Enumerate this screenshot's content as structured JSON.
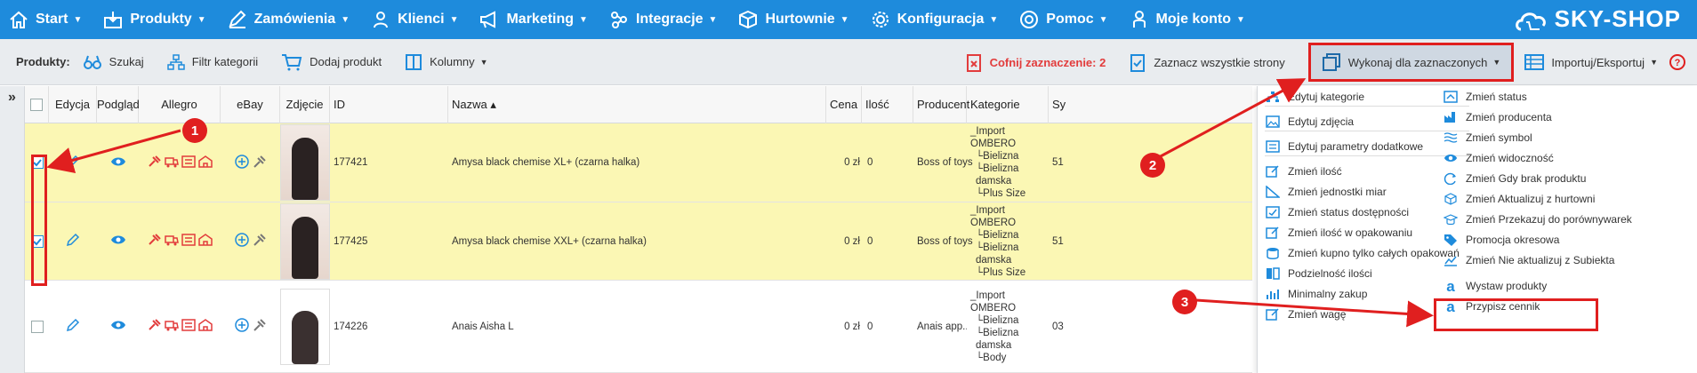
{
  "nav": {
    "items": [
      {
        "label": "Start",
        "icon": "home-icon"
      },
      {
        "label": "Produkty",
        "icon": "box-download-icon"
      },
      {
        "label": "Zamówienia",
        "icon": "pencil-icon"
      },
      {
        "label": "Klienci",
        "icon": "user-icon"
      },
      {
        "label": "Marketing",
        "icon": "megaphone-icon"
      },
      {
        "label": "Integracje",
        "icon": "share-nodes-icon"
      },
      {
        "label": "Hurtownie",
        "icon": "cube-icon"
      },
      {
        "label": "Konfiguracja",
        "icon": "gear-icon"
      },
      {
        "label": "Pomoc",
        "icon": "lifebuoy-icon"
      },
      {
        "label": "Moje konto",
        "icon": "person-icon"
      }
    ],
    "brand": "SKY-SHOP"
  },
  "toolbar": {
    "section_label": "Produkty:",
    "search": "Szukaj",
    "filter": "Filtr kategorii",
    "add": "Dodaj produkt",
    "columns": "Kolumny",
    "undo_selection": "Cofnij zaznaczenie: 2",
    "select_all": "Zaznacz wszystkie strony",
    "execute": "Wykonaj dla zaznaczonych",
    "import_export": "Importuj/Eksportuj"
  },
  "table": {
    "collapse": "»",
    "headers": [
      "Edycja",
      "Podgląd",
      "Allegro",
      "eBay",
      "Zdjęcie",
      "ID",
      "Nazwa ▴",
      "Cena",
      "Ilość",
      "Producent",
      "Kategorie",
      "Sy"
    ],
    "rows": [
      {
        "id": "177421",
        "name": "Amysa black chemise XL+ (czarna halka)",
        "price": "0 zł",
        "qty": "0",
        "producer": "Boss of toys",
        "cat1": "_Import OMBERO",
        "cat2": "└Bielizna",
        "cat3": "└Bielizna damska",
        "cat4": "└Plus Size",
        "sy": "51",
        "selected": true
      },
      {
        "id": "177425",
        "name": "Amysa black chemise XXL+ (czarna halka)",
        "price": "0 zł",
        "qty": "0",
        "producer": "Boss of toys",
        "cat1": "_Import OMBERO",
        "cat2": "└Bielizna",
        "cat3": "└Bielizna damska",
        "cat4": "└Plus Size",
        "sy": "51",
        "selected": true
      },
      {
        "id": "174226",
        "name": "Anais Aisha L",
        "price": "0 zł",
        "qty": "0",
        "producer": "Anais app...",
        "cat1": "_Import OMBERO",
        "cat2": "└Bielizna",
        "cat3": "└Bielizna damska",
        "cat4": "└Body",
        "sy": "03",
        "selected": false
      }
    ]
  },
  "menu": {
    "left": [
      "Edytuj kategorie",
      "Edytuj zdjęcia",
      "Edytuj parametry dodatkowe",
      "Zmień ilość",
      "Zmień jednostki miar",
      "Zmień status dostępności",
      "Zmień ilość w opakowaniu",
      "Zmień kupno tylko całych opakowań",
      "Podzielność ilości",
      "Minimalny zakup",
      "Zmień wagę"
    ],
    "right": [
      "Zmień status",
      "Zmień producenta",
      "Zmień symbol",
      "Zmień widoczność",
      "Zmień Gdy brak produktu",
      "Zmień Aktualizuj z hurtowni",
      "Zmień Przekazuj do porównywarek",
      "Promocja okresowa",
      "Zmień Nie aktualizuj z Subiekta",
      "Wystaw produkty",
      "Przypisz cennik"
    ]
  },
  "annotations": {
    "badges": [
      "1",
      "2",
      "3"
    ]
  },
  "colors": {
    "nav_bg": "#1e8bdc",
    "accent_red": "#e01f1f",
    "selected_row": "#fbf7b4",
    "icon_blue": "#1e8bdc",
    "allegro_red": "#e23c3c"
  }
}
